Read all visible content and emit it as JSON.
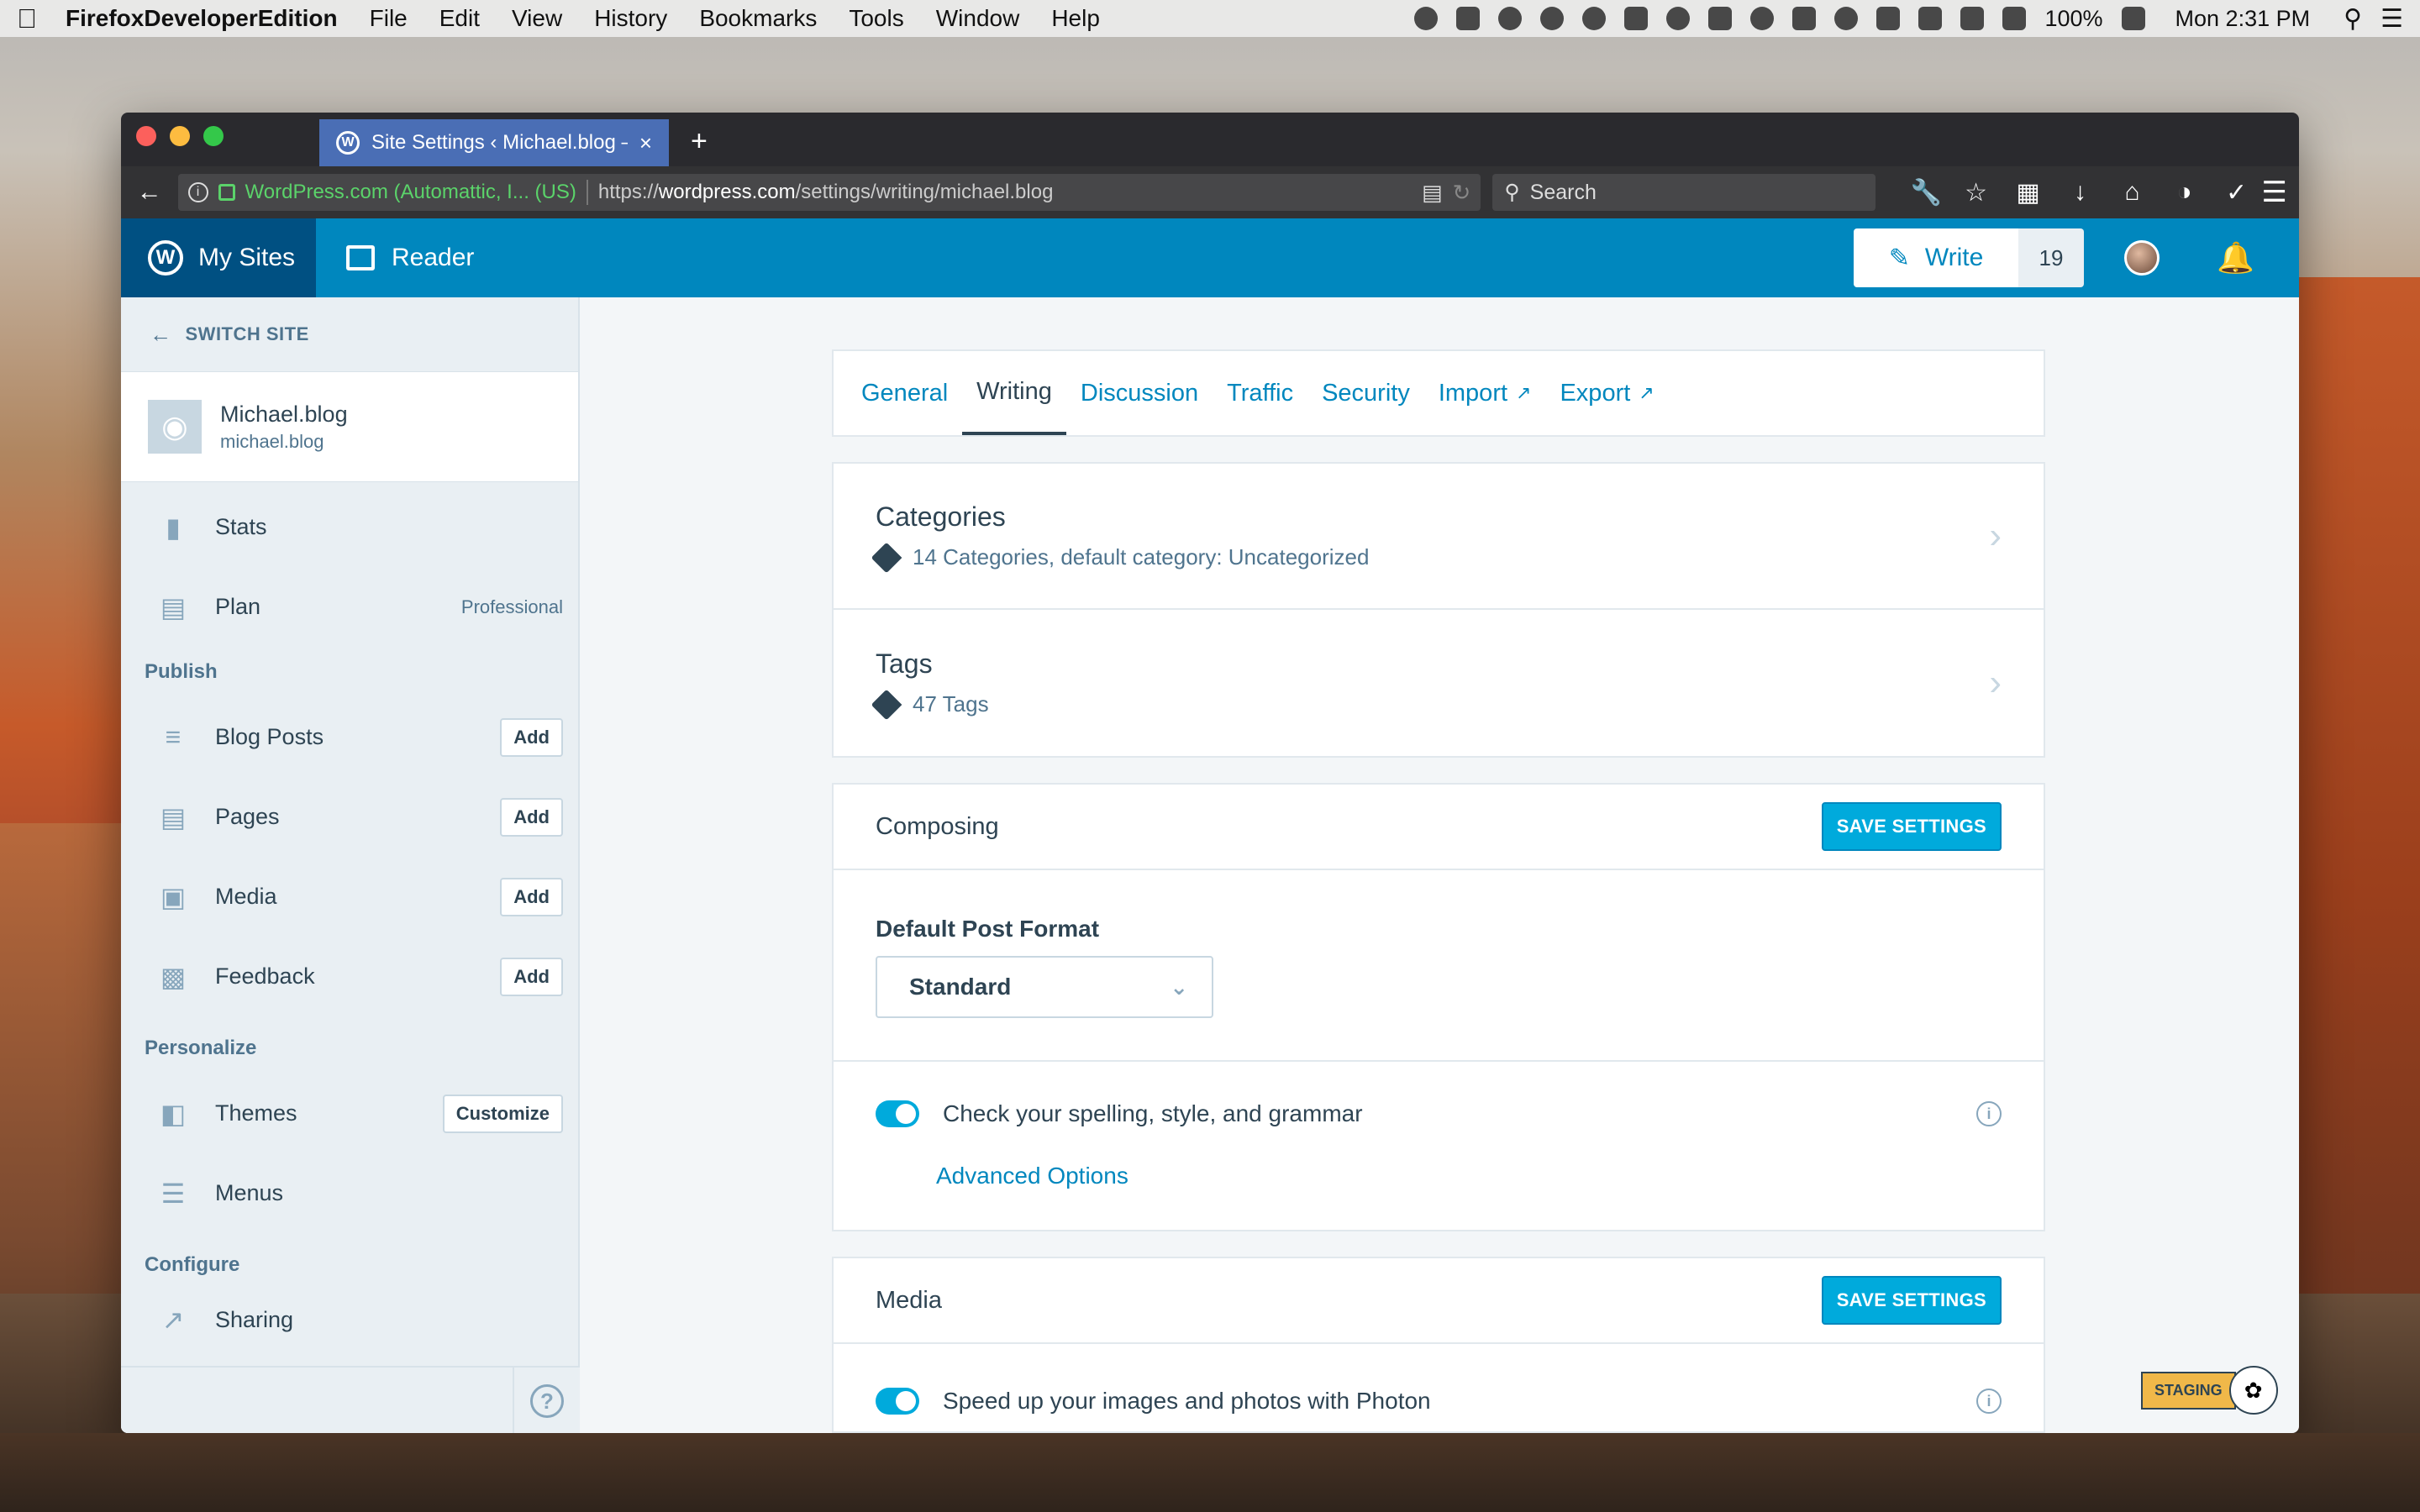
{
  "menubar": {
    "app_name": "FirefoxDeveloperEdition",
    "items": [
      "File",
      "Edit",
      "View",
      "History",
      "Bookmarks",
      "Tools",
      "Window",
      "Help"
    ],
    "battery": "100%",
    "clock": "Mon 2:31 PM"
  },
  "browser": {
    "tab_title": "Site Settings ‹ Michael.blog —",
    "tab_close": "×",
    "new_tab": "+",
    "identity": "WordPress.com (Automattic, I...  (US)",
    "url_prefix": "https://",
    "url_domain": "wordpress.com",
    "url_path": "/settings/writing/michael.blog",
    "search_placeholder": "Search"
  },
  "masterbar": {
    "my_sites": "My Sites",
    "reader": "Reader",
    "write": "Write",
    "write_count": "19"
  },
  "sidebar": {
    "switch_site": "SWITCH SITE",
    "site_name": "Michael.blog",
    "site_url": "michael.blog",
    "stats": "Stats",
    "plan": "Plan",
    "plan_meta": "Professional",
    "publish_header": "Publish",
    "blog_posts": "Blog Posts",
    "pages": "Pages",
    "media": "Media",
    "feedback": "Feedback",
    "add_label": "Add",
    "personalize_header": "Personalize",
    "themes": "Themes",
    "customize_label": "Customize",
    "menus": "Menus",
    "configure_header": "Configure",
    "sharing": "Sharing",
    "help_glyph": "?"
  },
  "settings_tabs": {
    "general": "General",
    "writing": "Writing",
    "discussion": "Discussion",
    "traffic": "Traffic",
    "security": "Security",
    "import": "Import",
    "export": "Export"
  },
  "taxonomies": {
    "categories_title": "Categories",
    "categories_sub": "14 Categories, default category: Uncategorized",
    "tags_title": "Tags",
    "tags_sub": "47 Tags"
  },
  "composing": {
    "title": "Composing",
    "save_label": "SAVE SETTINGS",
    "default_format_label": "Default Post Format",
    "default_format_value": "Standard",
    "spellcheck_label": "Check your spelling, style, and grammar",
    "advanced_link": "Advanced Options"
  },
  "media_section": {
    "title": "Media",
    "save_label": "SAVE SETTINGS",
    "photon_label": "Speed up your images and photos with Photon"
  },
  "staging": {
    "badge": "STAGING"
  },
  "colors": {
    "masterbar": "#0087be",
    "masterbar_active": "#005082",
    "primary_button": "#00aadc",
    "text": "#2e4453",
    "sidebar_bg": "#e9eff3"
  }
}
